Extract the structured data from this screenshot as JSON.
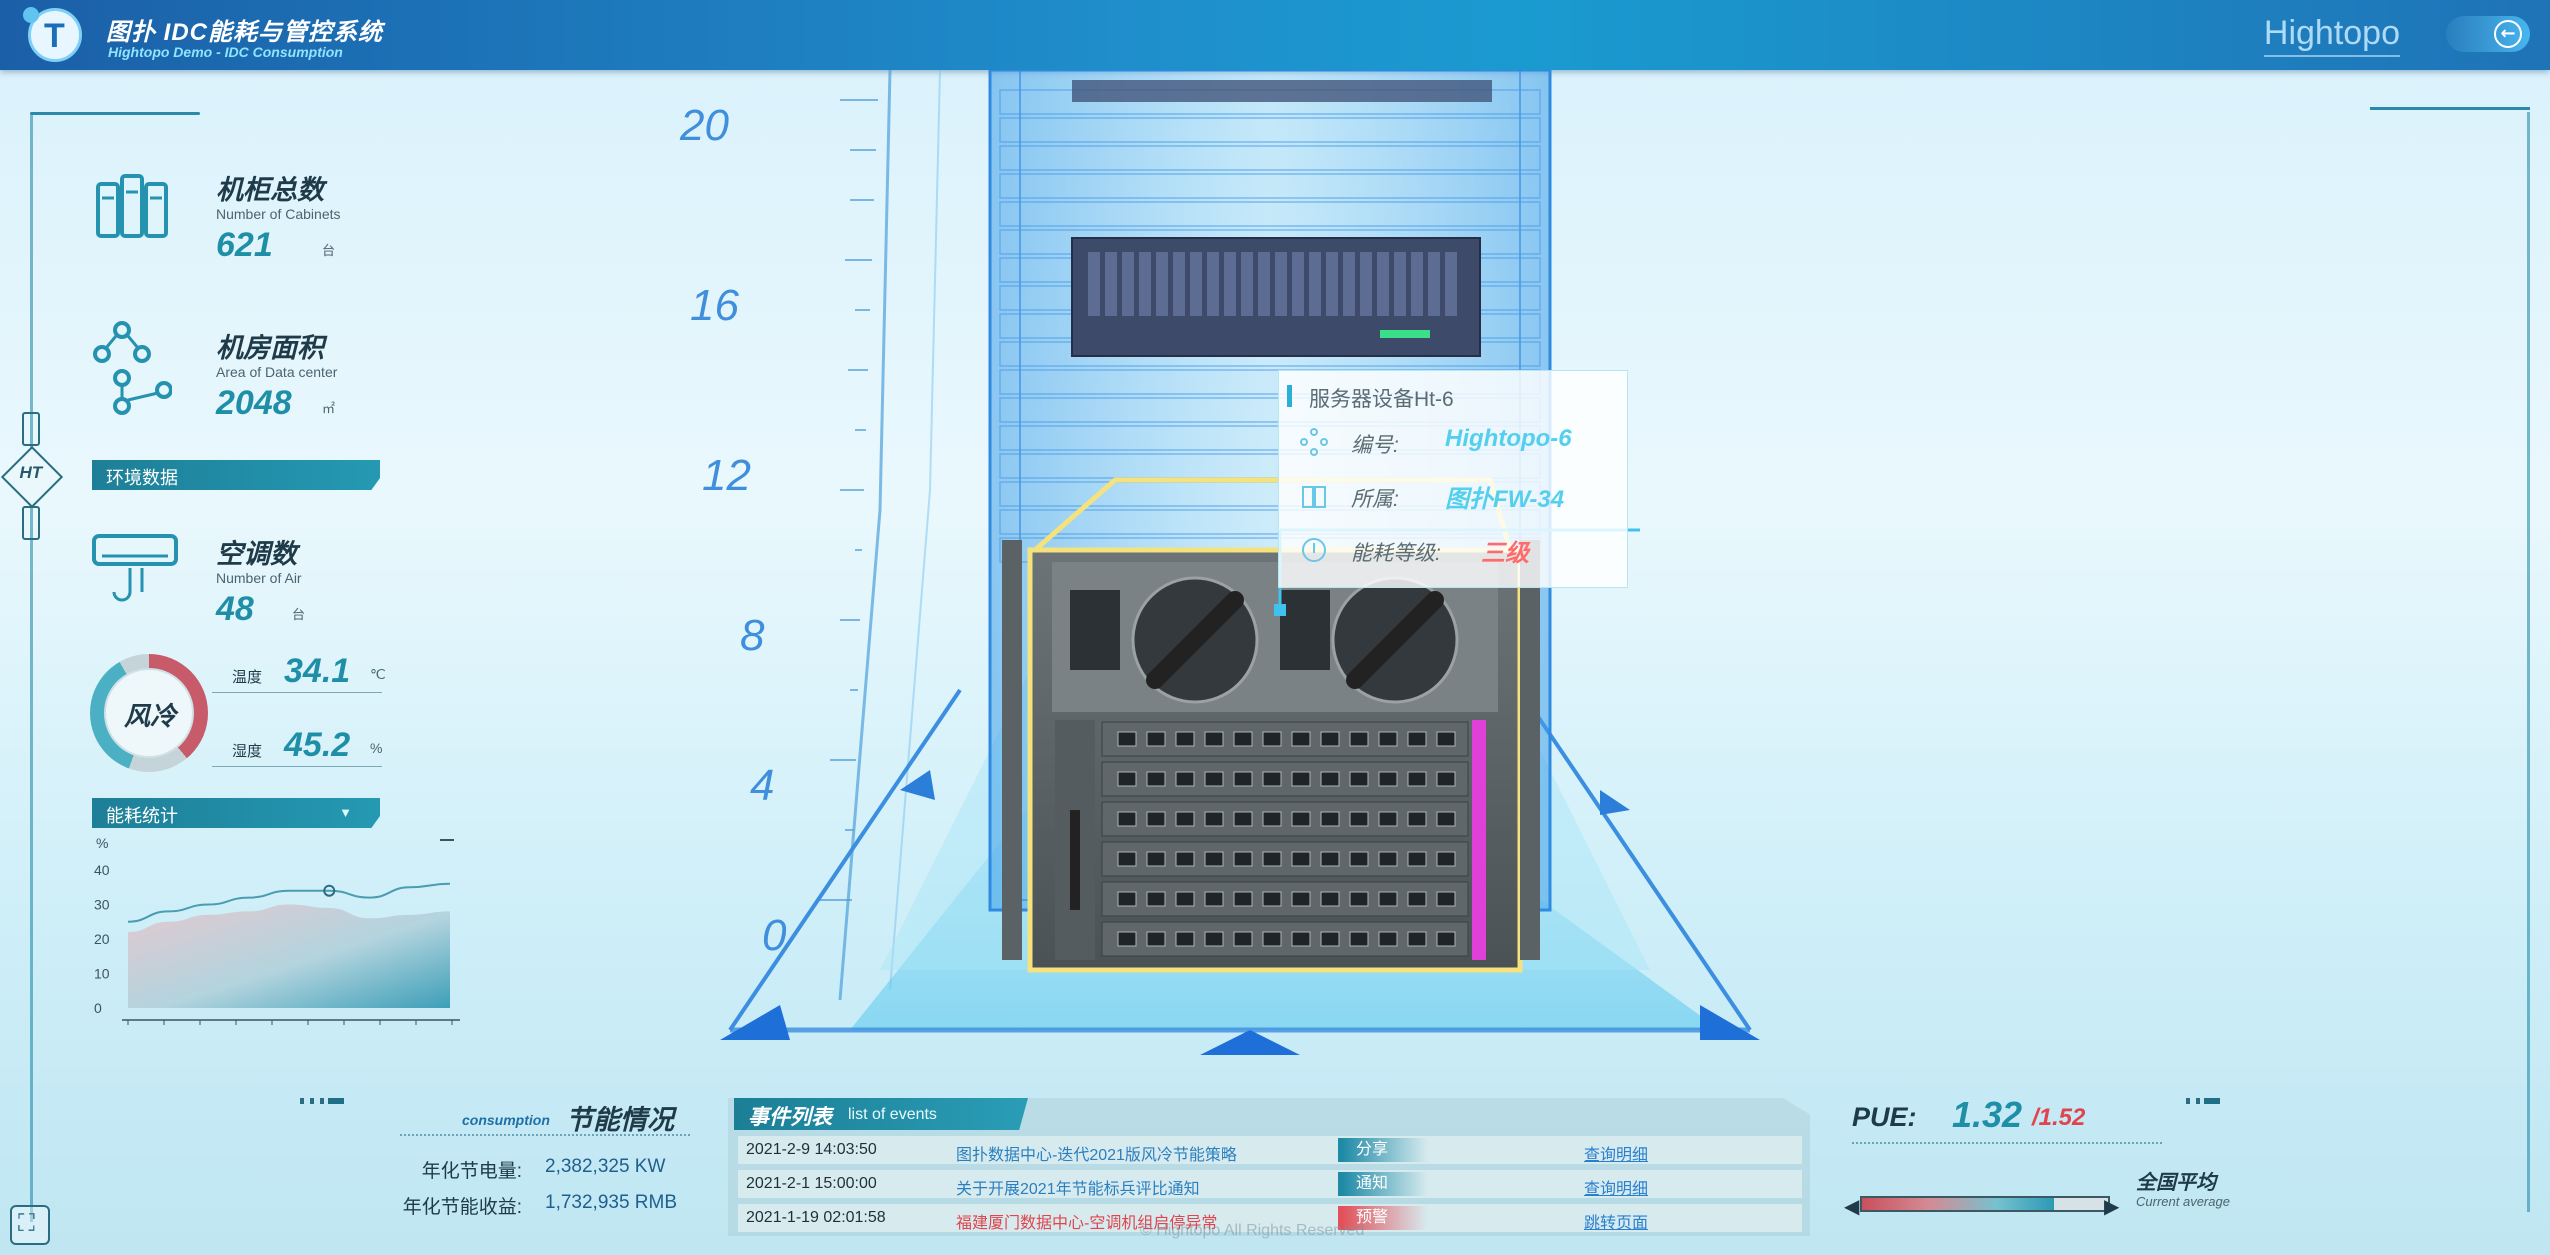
{
  "header": {
    "title": "图扑 IDC能耗与管控系统",
    "subtitle": "Hightopo Demo - IDC Consumption",
    "brand": "Hightopo"
  },
  "side": {
    "ht_label": "HT"
  },
  "stats": {
    "cabinets": {
      "label": "机柜总数",
      "label_en": "Number of Cabinets",
      "value": "621",
      "unit": "台"
    },
    "area": {
      "label": "机房面积",
      "label_en": "Area of Data center",
      "value": "2048",
      "unit": "㎡"
    },
    "air": {
      "label": "空调数",
      "label_en": "Number of Air",
      "value": "48",
      "unit": "台"
    }
  },
  "environment": {
    "section_title": "环境数据",
    "mode": "风冷",
    "temperature": {
      "label": "温度",
      "value": "34.1",
      "unit": "℃"
    },
    "humidity": {
      "label": "湿度",
      "value": "45.2",
      "unit": "%"
    }
  },
  "energy": {
    "section_title": "能耗统计",
    "unit_label": "%"
  },
  "chart_data": {
    "type": "area",
    "title": "",
    "xlabel": "",
    "ylabel": "%",
    "ylim": [
      0,
      40
    ],
    "yticks": [
      0,
      10,
      20,
      30,
      40
    ],
    "x": [
      0,
      1,
      2,
      3,
      4,
      5,
      6,
      7,
      8
    ],
    "series": [
      {
        "values": [
          22,
          25,
          27,
          28,
          30,
          29,
          26,
          27,
          28
        ]
      },
      {
        "values": [
          25,
          28,
          30,
          32,
          34,
          34,
          32,
          35,
          36
        ]
      }
    ],
    "grid": false
  },
  "scale": {
    "ticks": [
      "20",
      "16",
      "12",
      "8",
      "4",
      "0"
    ]
  },
  "tooltip": {
    "title": "服务器设备Ht-6",
    "rows": [
      {
        "label": "编号:",
        "value": "Hightopo-6",
        "icon": "node-icon"
      },
      {
        "label": "所属:",
        "value": "图扑FW-34",
        "icon": "book-icon"
      },
      {
        "label": "能耗等级:",
        "value": "三级",
        "icon": "thermometer-icon"
      }
    ]
  },
  "saving": {
    "title_en": "consumption",
    "title": "节能情况",
    "rows": [
      {
        "label": "年化节电量:",
        "value": "2,382,325 KW"
      },
      {
        "label": "年化节能收益:",
        "value": "1,732,935 RMB"
      }
    ]
  },
  "events": {
    "title": "事件列表",
    "title_en": "list of events",
    "rows": [
      {
        "time": "2021-2-9 14:03:50",
        "title": "图扑数据中心-迭代2021版风冷节能策略",
        "tag": "分享",
        "link": "查询明细",
        "alert": false
      },
      {
        "time": "2021-2-1 15:00:00",
        "title": "关于开展2021年节能标兵评比通知",
        "tag": "通知",
        "link": "查询明细",
        "alert": false
      },
      {
        "time": "2021-1-19 02:01:58",
        "title": "福建厦门数据中心-空调机组启停异常",
        "tag": "预警",
        "link": "跳转页面",
        "alert": true
      }
    ]
  },
  "pue": {
    "label": "PUE:",
    "value": "1.32",
    "average": "/1.52",
    "avg_label": "全国平均",
    "avg_label_en": "Current average",
    "level": 0.78
  },
  "footer": {
    "copyright": "© Hightopo All Rights Reserved"
  },
  "colors": {
    "accent": "#1f8fa8",
    "alert": "#e0454d",
    "header": "#1f8fcc"
  }
}
